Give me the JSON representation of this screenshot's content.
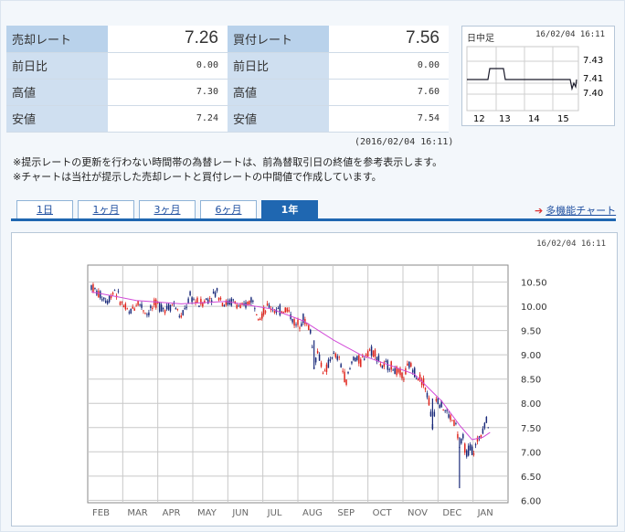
{
  "rates": {
    "rows": [
      {
        "l1": "売却レート",
        "v1": "7.26",
        "l2": "買付レート",
        "v2": "7.56"
      },
      {
        "l1": "前日比",
        "v1": "0.00",
        "l2": "前日比",
        "v2": "0.00"
      },
      {
        "l1": "高値",
        "v1": "7.30",
        "l2": "高値",
        "v2": "7.60"
      },
      {
        "l1": "安値",
        "v1": "7.24",
        "l2": "安値",
        "v2": "7.54"
      }
    ]
  },
  "mini_chart": {
    "label": "日中足",
    "datetime": "16/02/04 16:11",
    "x_ticks": [
      "12",
      "13",
      "14",
      "15"
    ],
    "y_ticks": [
      "7.43",
      "7.41",
      "7.40"
    ]
  },
  "timestamp": "(2016/02/04 16:11)",
  "notes": [
    "※提示レートの更新を行わない時間帯の為替レートは、前為替取引日の終値を参考表示します。",
    "※チャートは当社が提示した売却レートと買付レートの中間値で作成しています。"
  ],
  "tabs": [
    {
      "label": "1日"
    },
    {
      "label": "1ヶ月"
    },
    {
      "label": "3ヶ月"
    },
    {
      "label": "6ヶ月"
    },
    {
      "label": "1年"
    }
  ],
  "active_tab": 4,
  "multi_link": "多機能チャート",
  "panel_datetime": "16/02/04 16:11",
  "colors": {
    "up": "#e0231a",
    "down": "#1a2a7a",
    "ma": "#d24ad8",
    "accent": "#1f67b1"
  },
  "chart_data": {
    "type": "candlestick",
    "x_tick_labels": [
      "FEB",
      "MAR",
      "APR",
      "MAY",
      "JUN",
      "JUL",
      "AUG",
      "SEP",
      "OCT",
      "NOV",
      "DEC",
      "JAN"
    ],
    "y_ticks": [
      6.0,
      6.5,
      7.0,
      7.5,
      8.0,
      8.5,
      9.0,
      9.5,
      10.0,
      10.5
    ],
    "y_tick_labels": [
      "6.00",
      "6.50",
      "7.00",
      "7.50",
      "8.00",
      "8.50",
      "9.00",
      "9.50",
      "10.00",
      "10.50"
    ],
    "ylim": [
      5.95,
      10.85
    ],
    "grid": true,
    "price_path": [
      [
        0,
        10.42
      ],
      [
        4,
        10.25
      ],
      [
        9,
        10.12
      ],
      [
        13,
        10.35
      ],
      [
        17,
        10.05
      ],
      [
        21,
        9.85
      ],
      [
        26,
        10.1
      ],
      [
        31,
        9.85
      ],
      [
        36,
        10.05
      ],
      [
        41,
        9.95
      ],
      [
        46,
        10.05
      ],
      [
        50,
        9.75
      ],
      [
        55,
        10.2
      ],
      [
        60,
        10.05
      ],
      [
        65,
        10.15
      ],
      [
        70,
        10.3
      ],
      [
        74,
        10.05
      ],
      [
        79,
        10.1
      ],
      [
        84,
        9.95
      ],
      [
        89,
        10.15
      ],
      [
        94,
        9.8
      ],
      [
        99,
        10.0
      ],
      [
        104,
        9.9
      ],
      [
        109,
        9.95
      ],
      [
        114,
        9.6
      ],
      [
        118,
        9.75
      ],
      [
        122,
        9.5
      ],
      [
        124,
        8.8
      ],
      [
        126,
        9.05
      ],
      [
        130,
        8.6
      ],
      [
        134,
        9.0
      ],
      [
        138,
        8.9
      ],
      [
        142,
        8.45
      ],
      [
        146,
        8.95
      ],
      [
        150,
        8.85
      ],
      [
        154,
        9.1
      ],
      [
        158,
        9.05
      ],
      [
        162,
        8.75
      ],
      [
        166,
        8.8
      ],
      [
        170,
        8.65
      ],
      [
        174,
        8.55
      ],
      [
        177,
        8.8
      ],
      [
        181,
        8.6
      ],
      [
        185,
        8.45
      ],
      [
        188,
        8.05
      ],
      [
        190,
        7.5
      ],
      [
        192,
        8.15
      ],
      [
        196,
        7.9
      ],
      [
        200,
        7.7
      ],
      [
        203,
        7.55
      ],
      [
        205,
        7.1
      ],
      [
        207,
        7.25
      ],
      [
        209,
        6.95
      ],
      [
        211,
        7.1
      ],
      [
        213,
        7.0
      ],
      [
        215,
        7.2
      ],
      [
        218,
        7.5
      ],
      [
        220,
        7.65
      ],
      [
        222,
        7.4
      ]
    ],
    "ma_path": [
      [
        0,
        10.3
      ],
      [
        25,
        10.12
      ],
      [
        50,
        10.05
      ],
      [
        75,
        10.1
      ],
      [
        100,
        9.95
      ],
      [
        118,
        9.7
      ],
      [
        135,
        9.3
      ],
      [
        150,
        9.0
      ],
      [
        165,
        8.8
      ],
      [
        180,
        8.6
      ],
      [
        195,
        8.05
      ],
      [
        205,
        7.55
      ],
      [
        212,
        7.25
      ],
      [
        218,
        7.3
      ],
      [
        222,
        7.4
      ]
    ],
    "spikes": [
      {
        "t": 205,
        "low": 6.25,
        "high": 7.3
      },
      {
        "t": 190,
        "low": 7.45,
        "high": 8.1
      },
      {
        "t": 124,
        "low": 8.7,
        "high": 9.3
      }
    ]
  }
}
